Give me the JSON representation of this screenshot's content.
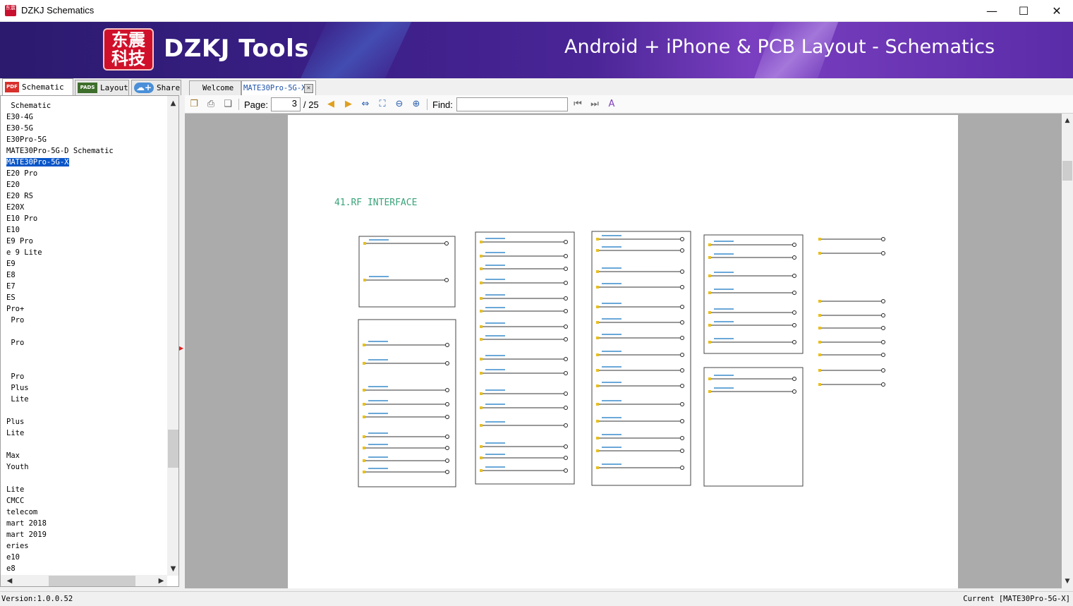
{
  "window": {
    "title": "DZKJ Schematics",
    "icon_text": "东震",
    "minimize": "—",
    "maximize": "☐",
    "close": "✕"
  },
  "banner": {
    "logo_chars": [
      "东震",
      "科技"
    ],
    "brand": "DZKJ Tools",
    "slogan": "Android + iPhone & PCB Layout - Schematics"
  },
  "mode_tabs": [
    {
      "label": "Schematic",
      "icon": "PDF",
      "icon_color": "#d8302c"
    },
    {
      "label": "Layout",
      "icon": "PADS",
      "icon_color": "#3e6e2c"
    },
    {
      "label": "Share",
      "icon": "cloud-add-icon",
      "icon_color": "#4a8fd8"
    }
  ],
  "tree": {
    "items": [
      " Schematic",
      "E30-4G",
      "E30-5G",
      "E30Pro-5G",
      "MATE30Pro-5G-D Schematic",
      "MATE30Pro-5G-X",
      "E20 Pro",
      "E20",
      "E20 RS",
      "E20X",
      "E10 Pro",
      "E10",
      "E9 Pro",
      "e 9 Lite",
      "E9",
      "E8",
      "E7",
      "ES",
      "Pro+",
      " Pro",
      "",
      " Pro",
      "",
      "",
      " Pro",
      " Plus",
      " Lite",
      "",
      "Plus",
      "Lite",
      "",
      "Max",
      "Youth",
      "",
      "Lite",
      "CMCC",
      "telecom",
      "mart 2018",
      "mart 2019",
      "eries",
      "e10",
      "e8"
    ],
    "selected_index": 5
  },
  "doc_tabs": [
    {
      "label": "Welcome"
    },
    {
      "label": "MATE30Pro-5G-X",
      "close": "✕"
    }
  ],
  "toolbar": {
    "page_label": "Page:",
    "page_value": "3",
    "page_total": "/ 25",
    "find_label": "Find:",
    "find_value": ""
  },
  "schematic": {
    "title": "41.RF  INTERFACE"
  },
  "status": {
    "version": "Version:1.0.0.52",
    "current": "Current [MATE30Pro-5G-X]"
  },
  "colors": {
    "schematic_title": "#3aa37a",
    "net_label": "#6aa8d8",
    "pin": "#e8c020",
    "selection": "#0a56c8"
  }
}
